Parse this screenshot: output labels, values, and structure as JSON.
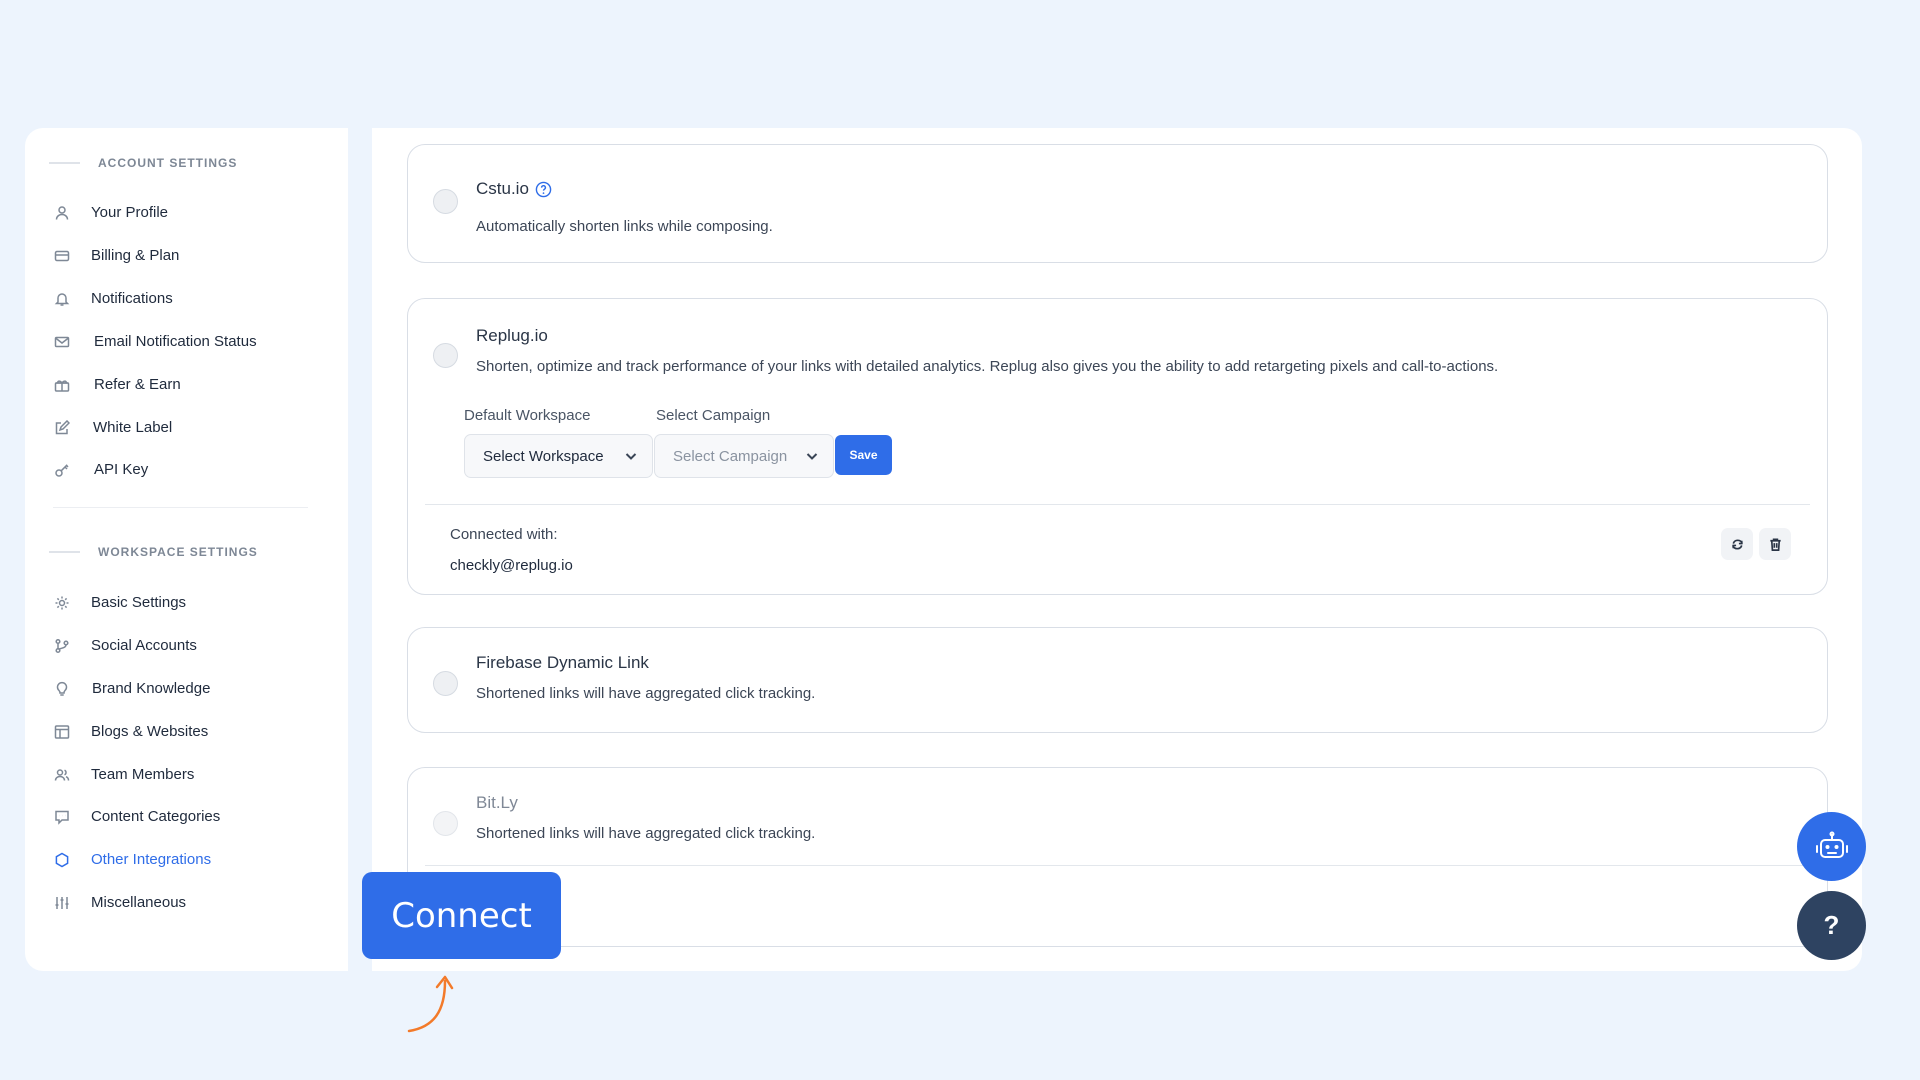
{
  "sidebar": {
    "account_heading": "ACCOUNT SETTINGS",
    "account_items": [
      {
        "label": "Your Profile",
        "icon": "user-icon"
      },
      {
        "label": "Billing & Plan",
        "icon": "credit-card-icon"
      },
      {
        "label": "Notifications",
        "icon": "bell-icon"
      },
      {
        "label": "Email Notification Status",
        "icon": "mail-icon"
      },
      {
        "label": "Refer & Earn",
        "icon": "gift-icon"
      },
      {
        "label": "White Label",
        "icon": "edit-icon"
      },
      {
        "label": "API Key",
        "icon": "key-icon"
      }
    ],
    "workspace_heading": "WORKSPACE SETTINGS",
    "workspace_items": [
      {
        "label": "Basic Settings",
        "icon": "gear-icon"
      },
      {
        "label": "Social Accounts",
        "icon": "share-icon"
      },
      {
        "label": "Brand Knowledge",
        "icon": "lightbulb-icon"
      },
      {
        "label": "Blogs & Websites",
        "icon": "layout-icon"
      },
      {
        "label": "Team Members",
        "icon": "users-icon"
      },
      {
        "label": "Content Categories",
        "icon": "chat-icon"
      },
      {
        "label": "Other Integrations",
        "icon": "hexagon-icon",
        "active": true
      },
      {
        "label": "Miscellaneous",
        "icon": "sliders-icon"
      }
    ]
  },
  "integrations": {
    "cstu": {
      "title": "Cstu.io",
      "description": "Automatically shorten links while composing."
    },
    "replug": {
      "title": "Replug.io",
      "description": "Shorten, optimize and track performance of your links with detailed analytics. Replug also gives you the ability to add retargeting pixels and call-to-actions.",
      "workspace_label": "Default Workspace",
      "workspace_value": "Select Workspace",
      "campaign_label": "Select Campaign",
      "campaign_value": "Select Campaign",
      "save_label": "Save",
      "connected_label": "Connected with:",
      "connected_email": "checkly@replug.io"
    },
    "firebase": {
      "title": "Firebase Dynamic Link",
      "description": "Shortened links will have aggregated click tracking."
    },
    "bitly": {
      "title": "Bit.Ly",
      "description": "Shortened links will have aggregated click tracking."
    }
  },
  "floating": {
    "connect_label": "Connect",
    "help_label": "?"
  },
  "colors": {
    "accent": "#2f6de8",
    "background": "#edf4fd",
    "help_button": "#2e4361",
    "arrow": "#f37a2a"
  }
}
